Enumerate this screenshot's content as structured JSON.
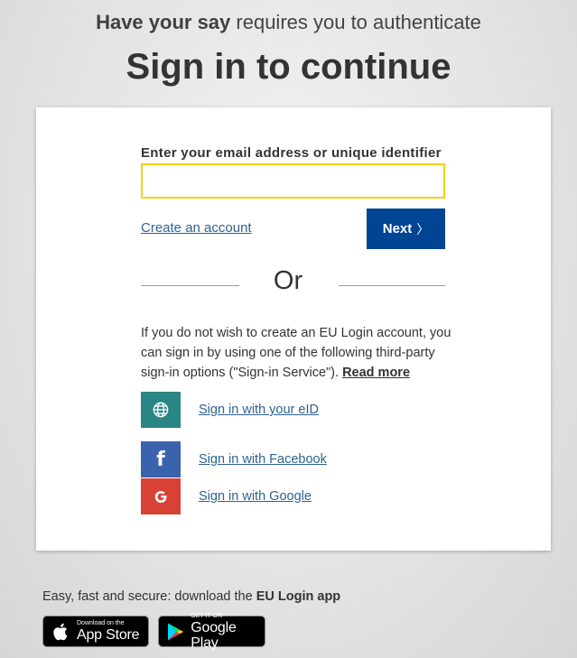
{
  "header": {
    "app_name": "Have your say",
    "subtitle_rest": " requires you to authenticate",
    "title": "Sign in to continue"
  },
  "login": {
    "email_label": "Enter your email address or unique identifier",
    "email_value": "",
    "create_account": "Create an account",
    "next_label": "Next",
    "next_chevron": "〉",
    "or_text": "Or"
  },
  "third_party": {
    "info_text": "If you do not wish to create an EU Login account, you can sign in by using one of the following third-party sign-in options (\"Sign-in Service\"). ",
    "read_more": "Read more",
    "providers": [
      {
        "icon": "globe-icon",
        "label": "Sign in with your eID",
        "color": "#2a8585"
      },
      {
        "icon": "facebook-icon",
        "label": "Sign in with Facebook",
        "color": "#3b62ad",
        "glyph": "f"
      },
      {
        "icon": "google-icon",
        "label": "Sign in with Google",
        "color": "#d84235"
      }
    ]
  },
  "footer": {
    "text": "Easy, fast and secure: download the ",
    "app_name": "EU Login app",
    "app_store_small": "Download on the",
    "app_store_big": "App Store",
    "google_play_small": "GET IT ON",
    "google_play_big": "Google Play"
  },
  "colors": {
    "primary": "#004494",
    "input_border": "#f2d20f",
    "link": "#2f6290"
  }
}
